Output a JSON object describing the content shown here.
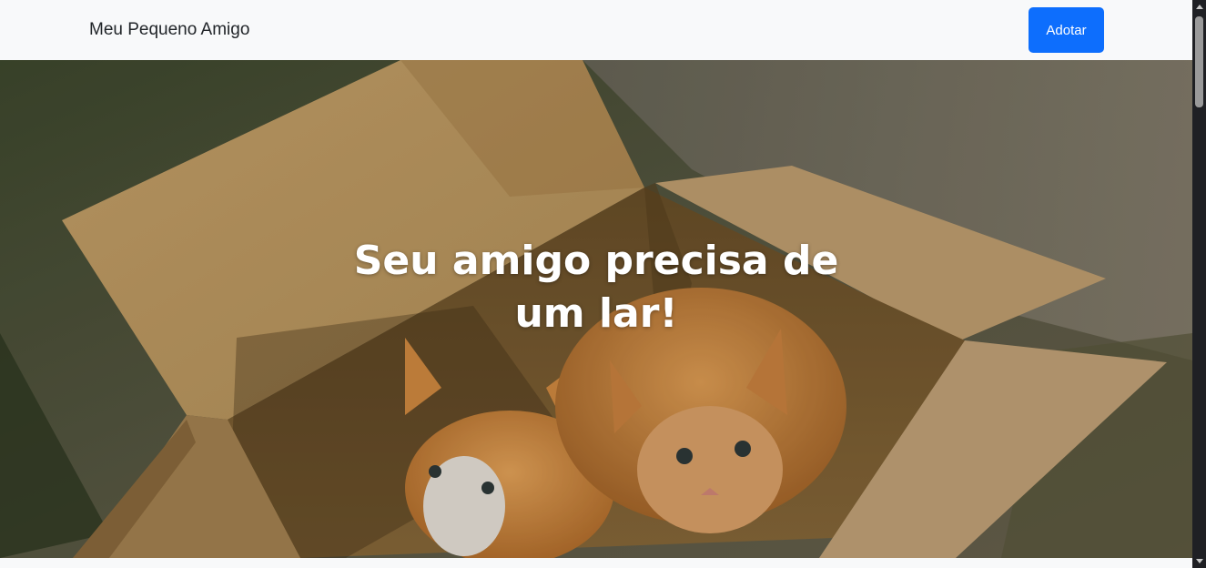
{
  "navbar": {
    "brand": "Meu Pequeno Amigo",
    "adopt_button": "Adotar",
    "button_color": "#0d6efd"
  },
  "hero": {
    "title": "Seu amigo precisa de um lar!",
    "image_subject": "two orange kittens in a cardboard box"
  }
}
